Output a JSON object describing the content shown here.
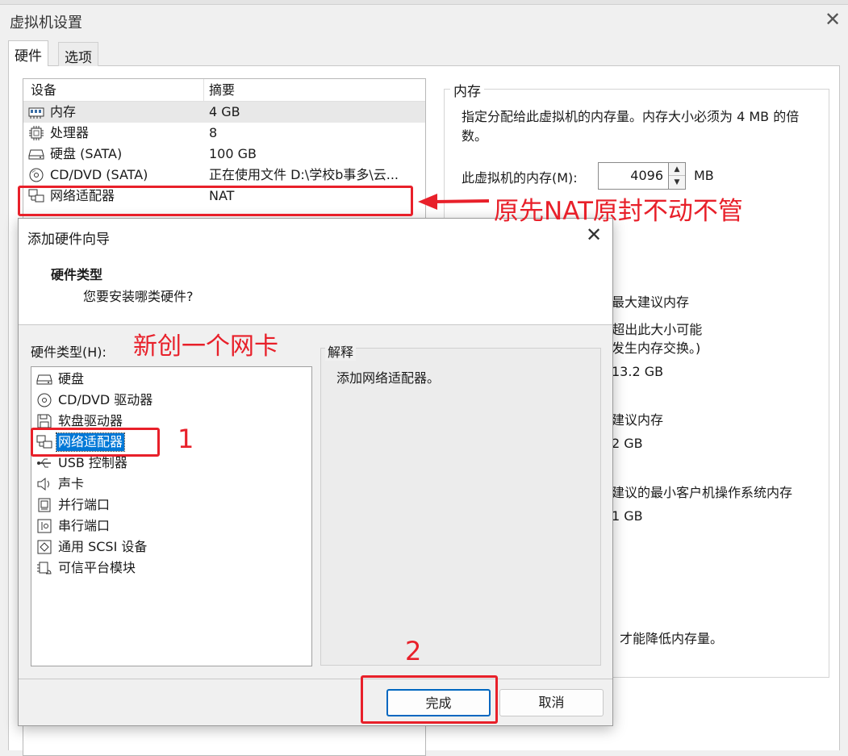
{
  "window": {
    "title": "虚拟机设置",
    "close_glyph": "✕"
  },
  "tabs": [
    {
      "label": "硬件"
    },
    {
      "label": "选项"
    }
  ],
  "device_list": {
    "headers": {
      "device": "设备",
      "summary": "摘要"
    },
    "rows": [
      {
        "name": "内存",
        "summary": "4 GB",
        "icon": "memory-icon"
      },
      {
        "name": "处理器",
        "summary": "8",
        "icon": "processor-icon"
      },
      {
        "name": "硬盘 (SATA)",
        "summary": "100 GB",
        "icon": "hard-disk-icon"
      },
      {
        "name": "CD/DVD (SATA)",
        "summary": "正在使用文件 D:\\学校b事多\\云...",
        "icon": "cd-dvd-icon"
      },
      {
        "name": "网络适配器",
        "summary": "NAT",
        "icon": "network-adapter-icon"
      }
    ]
  },
  "memory": {
    "legend": "内存",
    "description": "指定分配给此虚拟机的内存量。内存大小必须为 4 MB 的倍数。",
    "label": "此虚拟机的内存(M):",
    "value": "4096",
    "unit": "MB",
    "partial_lines": [
      "最大建议内存",
      "(超出此大小可能",
      "发生内存交换。)",
      "13.2 GB",
      "建议内存",
      "2 GB",
      "建议的最小客户机操作系统内存",
      "1 GB",
      "才能降低内存量。"
    ]
  },
  "annotations": {
    "nat_note": "原先NAT原封不动不管",
    "new_nic": "新创一个网卡",
    "step1": "1",
    "step2": "2",
    "color": "#e8202a"
  },
  "dialog": {
    "title": "添加硬件向导",
    "close_glyph": "✕",
    "heading": "硬件类型",
    "subheading": "您要安装哪类硬件?",
    "hw_type_label": "硬件类型(H):",
    "hw_types": [
      {
        "name": "硬盘",
        "icon": "hard-disk-icon"
      },
      {
        "name": "CD/DVD 驱动器",
        "icon": "cd-dvd-icon"
      },
      {
        "name": "软盘驱动器",
        "icon": "floppy-icon"
      },
      {
        "name": "网络适配器",
        "icon": "network-adapter-icon",
        "selected": true
      },
      {
        "name": "USB 控制器",
        "icon": "usb-icon"
      },
      {
        "name": "声卡",
        "icon": "speaker-icon"
      },
      {
        "name": "并行端口",
        "icon": "parallel-port-icon"
      },
      {
        "name": "串行端口",
        "icon": "serial-port-icon"
      },
      {
        "name": "通用 SCSI 设备",
        "icon": "scsi-icon"
      },
      {
        "name": "可信平台模块",
        "icon": "tpm-icon"
      }
    ],
    "explanation_legend": "解释",
    "explanation": "添加网络适配器。",
    "finish_label": "完成",
    "cancel_label": "取消",
    "selection_color": "#0078d7"
  }
}
